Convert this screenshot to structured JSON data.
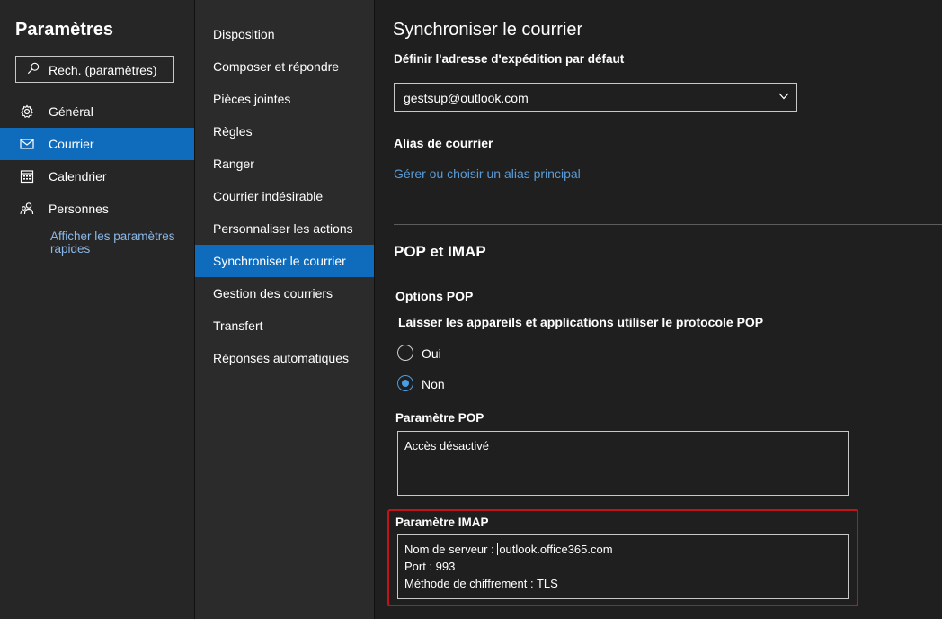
{
  "left_pane": {
    "title": "Paramètres",
    "search_label": "Rech. (paramètres)",
    "items": [
      {
        "label": "Général",
        "icon": "gear-icon"
      },
      {
        "label": "Courrier",
        "icon": "mail-icon"
      },
      {
        "label": "Calendrier",
        "icon": "calendar-icon"
      },
      {
        "label": "Personnes",
        "icon": "people-icon"
      }
    ],
    "quick_settings_link": "Afficher les paramètres rapides"
  },
  "middle_pane": {
    "items": [
      "Disposition",
      "Composer et répondre",
      "Pièces jointes",
      "Règles",
      "Ranger",
      "Courrier indésirable",
      "Personnaliser les actions",
      "Synchroniser le courrier",
      "Gestion des courriers",
      "Transfert",
      "Réponses automatiques"
    ],
    "selected": "Synchroniser le courrier"
  },
  "right_pane": {
    "title": "Synchroniser le courrier",
    "default_from_label": "Définir l'adresse d'expédition par défaut",
    "default_from_value": "gestsup@outlook.com",
    "alias_heading": "Alias de courrier",
    "alias_link": "Gérer ou choisir un alias principal",
    "pop_imap_heading": "POP et IMAP",
    "pop_options_heading": "Options POP",
    "pop_question": "Laisser les appareils et applications utiliser le protocole POP",
    "radio_yes": "Oui",
    "radio_no": "Non",
    "radio_selected": "Non",
    "pop_setting_label": "Paramètre POP",
    "pop_setting_value": "Accès désactivé",
    "imap_setting_label": "Paramètre IMAP",
    "imap_server_prefix": "Nom de serveur : ",
    "imap_server_value": "outlook.office365.com",
    "imap_port": "Port : 993",
    "imap_encryption": "Méthode de chiffrement : TLS"
  },
  "colors": {
    "accent": "#0f6cbd",
    "link": "#5a9bd4",
    "highlight_border": "#c0141a"
  }
}
